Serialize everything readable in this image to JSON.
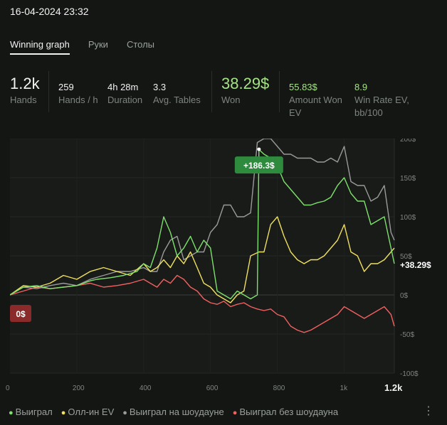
{
  "header": {
    "title": "16-04-2024 23:32"
  },
  "tabs": [
    {
      "label": "Winning graph",
      "active": true
    },
    {
      "label": "Руки",
      "active": false
    },
    {
      "label": "Столы",
      "active": false
    }
  ],
  "stats": {
    "hands": {
      "value": "1.2k",
      "label": "Hands"
    },
    "hands_per_hour": {
      "value": "259",
      "label": "Hands / h"
    },
    "duration": {
      "value": "4h 28m",
      "label": "Duration"
    },
    "avg_tables": {
      "value": "3.3",
      "label": "Avg. Tables"
    },
    "won": {
      "value": "38.29$",
      "label": "Won"
    },
    "amount_won_ev": {
      "value": "55.83$",
      "label_line1": "Amount Won",
      "label_line2": "EV"
    },
    "win_rate_ev": {
      "value": "8.9",
      "label_line1": "Win Rate EV,",
      "label_line2": "bb/100"
    }
  },
  "legend": [
    {
      "label": "Выиграл",
      "color": "#7ee06c"
    },
    {
      "label": "Олл-ин EV",
      "color": "#f0e060"
    },
    {
      "label": "Выиграл на шоудауне",
      "color": "#9a9a9a"
    },
    {
      "label": "Выиграл без шоудауна",
      "color": "#f06060"
    }
  ],
  "more_icon": "kebab-menu-icon",
  "chart_data": {
    "type": "line",
    "xlim": [
      0,
      1150
    ],
    "ylim": [
      -100,
      200
    ],
    "y_ticks": [
      "200$",
      "150$",
      "100$",
      "50$",
      "0$",
      "-50$",
      "-100$"
    ],
    "y_tick_values": [
      200,
      150,
      100,
      50,
      0,
      -50,
      -100
    ],
    "x_ticks": [
      "0",
      "200",
      "400",
      "600",
      "800",
      "1k"
    ],
    "x_tick_values": [
      0,
      200,
      400,
      600,
      800,
      1000
    ],
    "x_current_label": "1.2k",
    "start_label": "0$",
    "peak_label": "+186.3$",
    "peak": {
      "x": 745,
      "y": 186.3
    },
    "end_label": "+38.29$",
    "end_value": 38.29,
    "series": [
      {
        "name": "Выиграл",
        "color": "#7ee06c",
        "x": [
          0,
          40,
          80,
          120,
          160,
          200,
          240,
          260,
          300,
          340,
          380,
          400,
          420,
          440,
          460,
          480,
          500,
          520,
          540,
          560,
          580,
          600,
          620,
          640,
          660,
          680,
          700,
          720,
          740,
          745,
          760,
          780,
          800,
          820,
          840,
          860,
          880,
          900,
          920,
          940,
          960,
          980,
          1000,
          1020,
          1040,
          1060,
          1080,
          1100,
          1120,
          1140,
          1150
        ],
        "y": [
          0,
          10,
          12,
          8,
          10,
          12,
          18,
          20,
          22,
          25,
          30,
          40,
          35,
          60,
          100,
          80,
          50,
          60,
          75,
          55,
          70,
          60,
          5,
          0,
          -5,
          5,
          0,
          -5,
          0,
          186,
          180,
          175,
          165,
          145,
          135,
          125,
          115,
          115,
          118,
          120,
          125,
          140,
          150,
          130,
          120,
          120,
          90,
          95,
          100,
          60,
          40
        ]
      },
      {
        "name": "Олл-ин EV",
        "color": "#f0e060",
        "x": [
          0,
          40,
          80,
          120,
          160,
          200,
          240,
          280,
          320,
          360,
          400,
          420,
          440,
          460,
          480,
          500,
          520,
          540,
          560,
          580,
          600,
          620,
          640,
          660,
          680,
          700,
          720,
          745,
          760,
          780,
          800,
          820,
          840,
          860,
          880,
          900,
          920,
          940,
          960,
          980,
          1000,
          1020,
          1040,
          1060,
          1080,
          1100,
          1120,
          1140,
          1150
        ],
        "y": [
          0,
          12,
          10,
          15,
          25,
          20,
          30,
          35,
          30,
          25,
          40,
          30,
          35,
          45,
          35,
          50,
          40,
          55,
          35,
          15,
          10,
          0,
          -5,
          -10,
          0,
          5,
          50,
          55,
          55,
          90,
          100,
          75,
          55,
          45,
          40,
          45,
          45,
          50,
          60,
          70,
          90,
          55,
          50,
          30,
          40,
          40,
          45,
          55,
          60
        ]
      },
      {
        "name": "Выиграл на шоудауне",
        "color": "#9a9a9a",
        "x": [
          0,
          40,
          80,
          120,
          160,
          200,
          240,
          280,
          320,
          360,
          400,
          420,
          440,
          460,
          480,
          500,
          520,
          540,
          560,
          580,
          600,
          620,
          640,
          660,
          680,
          700,
          720,
          740,
          760,
          780,
          800,
          820,
          840,
          860,
          880,
          900,
          920,
          940,
          960,
          980,
          1000,
          1020,
          1040,
          1060,
          1080,
          1100,
          1120,
          1140,
          1150
        ],
        "y": [
          0,
          10,
          8,
          12,
          15,
          12,
          20,
          25,
          30,
          30,
          35,
          30,
          30,
          55,
          70,
          75,
          45,
          50,
          55,
          55,
          80,
          90,
          115,
          115,
          100,
          100,
          105,
          195,
          200,
          200,
          190,
          180,
          180,
          175,
          175,
          175,
          170,
          170,
          175,
          170,
          190,
          145,
          140,
          140,
          120,
          125,
          140,
          80,
          70
        ]
      },
      {
        "name": "Выиграл без шоудауна",
        "color": "#f06060",
        "x": [
          0,
          40,
          80,
          120,
          160,
          200,
          240,
          280,
          320,
          360,
          400,
          420,
          440,
          460,
          480,
          500,
          520,
          540,
          560,
          580,
          600,
          620,
          640,
          660,
          680,
          700,
          720,
          740,
          760,
          780,
          800,
          820,
          840,
          860,
          880,
          900,
          920,
          940,
          960,
          980,
          1000,
          1020,
          1040,
          1060,
          1080,
          1100,
          1120,
          1140,
          1150
        ],
        "y": [
          0,
          5,
          10,
          8,
          10,
          12,
          15,
          10,
          12,
          15,
          20,
          15,
          10,
          20,
          15,
          25,
          20,
          10,
          5,
          -5,
          -10,
          -12,
          -8,
          -15,
          -12,
          -10,
          -15,
          -18,
          -20,
          -18,
          -25,
          -28,
          -40,
          -45,
          -48,
          -45,
          -40,
          -35,
          -30,
          -25,
          -15,
          -20,
          -25,
          -30,
          -25,
          -20,
          -15,
          -25,
          -40
        ]
      }
    ]
  }
}
